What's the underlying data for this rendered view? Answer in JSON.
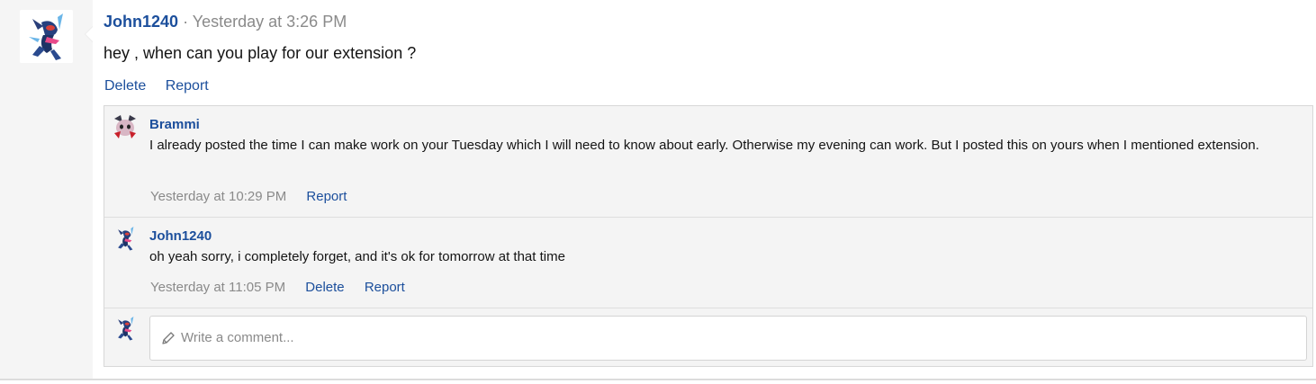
{
  "post": {
    "author": "John1240",
    "separator": "·",
    "timestamp": "Yesterday at 3:26 PM",
    "message": "hey , when can you play for our extension ?",
    "actions": {
      "delete": "Delete",
      "report": "Report"
    }
  },
  "comments": [
    {
      "author": "Brammi",
      "text": "I already posted the time I can make work on your Tuesday which I will need to know about early. Otherwise my evening can work. But I posted this on yours when I mentioned extension.",
      "timestamp": "Yesterday at 10:29 PM",
      "report": "Report"
    },
    {
      "author": "John1240",
      "text": "oh yeah sorry, i completely forget, and it's ok for tomorrow at that time",
      "timestamp": "Yesterday at 11:05 PM",
      "delete": "Delete",
      "report": "Report"
    }
  ],
  "composer": {
    "placeholder": "Write a comment..."
  },
  "colors": {
    "link": "#1c4f9c",
    "muted": "#8a8a8a",
    "panel": "#f4f4f4",
    "rail": "#f5f5f5"
  },
  "icons": {
    "post_avatar": "ninja-frog-avatar",
    "brammi_avatar": "pink-creature-avatar",
    "composer_icon": "pencil-icon"
  }
}
